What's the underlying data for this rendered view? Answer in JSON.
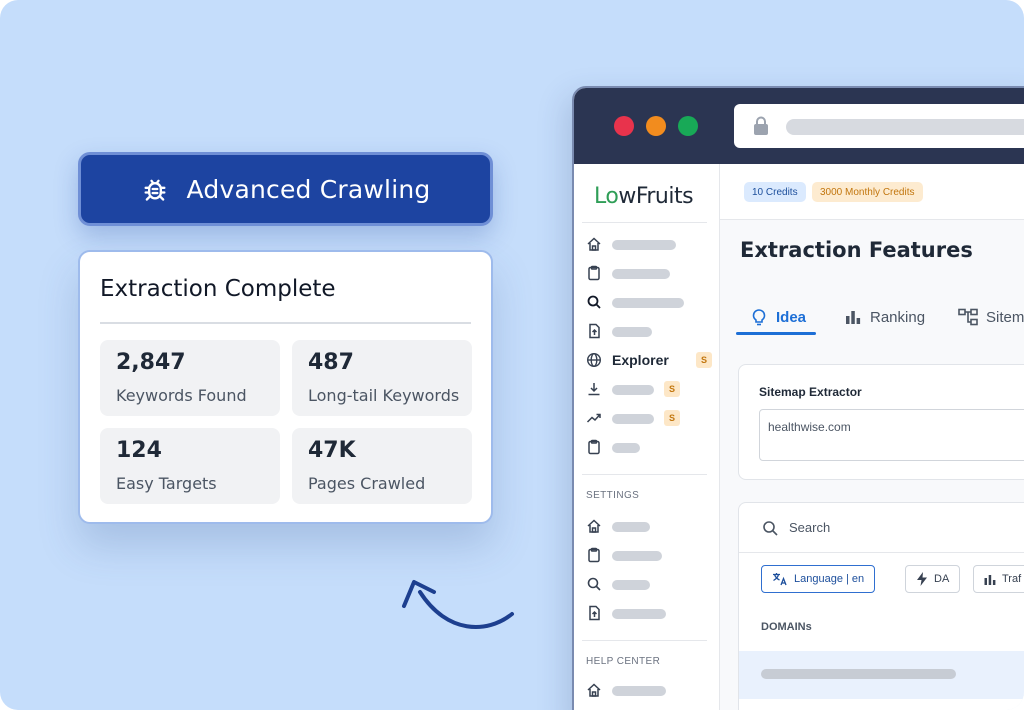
{
  "callout": {
    "feature_label": "Advanced Crawling",
    "card_title": "Extraction Complete",
    "stats": [
      {
        "value": "2,847",
        "label": "Keywords Found"
      },
      {
        "value": "487",
        "label": "Long-tail Keywords"
      },
      {
        "value": "124",
        "label": "Easy Targets"
      },
      {
        "value": "47K",
        "label": "Pages Crawled"
      }
    ]
  },
  "colors": {
    "background": "#c5ddfb",
    "feature_blue": "#1d44a1",
    "titlebar": "#2b3552",
    "dot_red": "#e8334c",
    "dot_orange": "#f28c1e",
    "dot_green": "#18a957",
    "accent_blue": "#1d6fd6",
    "logo_green": "#2f9e57"
  },
  "app": {
    "logo_prefix": "L",
    "logo_o": "o",
    "logo_rest": "wFruits",
    "credits_chip": "10 Credits",
    "monthly_chip": "3000 Monthly Credits",
    "page_title": "Extraction Features",
    "tabs": [
      {
        "label": "Idea",
        "icon": "lightbulb-icon"
      },
      {
        "label": "Ranking",
        "icon": "bar-chart-icon"
      },
      {
        "label": "Sitem",
        "icon": "sitemap-icon"
      }
    ],
    "sidebar": {
      "explorer_label": "Explorer",
      "badge": "S",
      "settings_heading": "SETTINGS",
      "help_heading": "HELP CENTER"
    },
    "sitemap_panel": {
      "label": "Sitemap Extractor",
      "input_value": "healthwise.com"
    },
    "results_panel": {
      "search_placeholder": "Search",
      "filter_language": "Language | en",
      "filter_da": "DA",
      "filter_traffic": "Traf",
      "column_domains": "DOMAINs"
    }
  }
}
